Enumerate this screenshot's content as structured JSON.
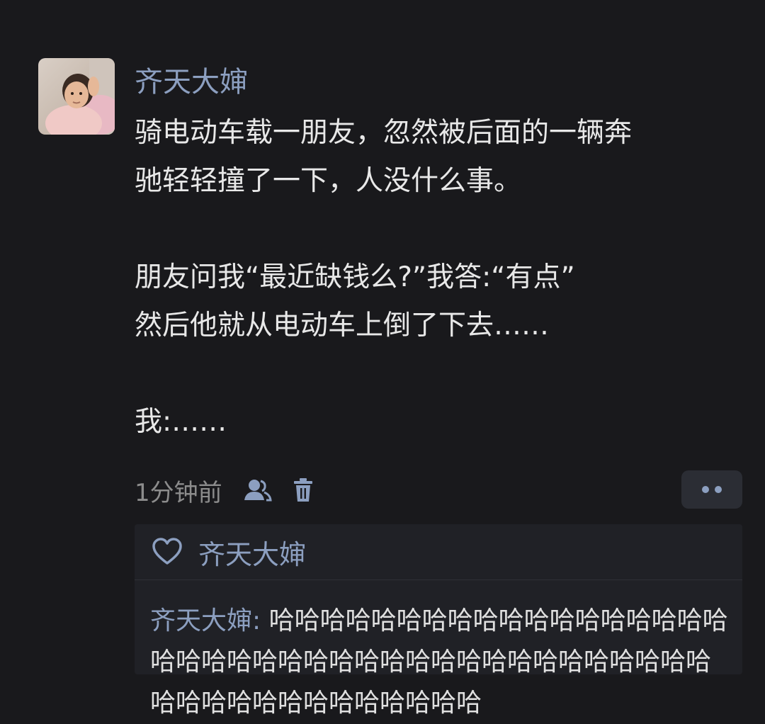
{
  "post": {
    "username": "齐天大婶",
    "lines": [
      "骑电动车载一朋友，忽然被后面的一辆奔",
      "驰轻轻撞了一下，人没什么事。",
      "",
      "朋友问我“最近缺钱么?”我答:“有点”",
      "然后他就从电动车上倒了下去……",
      "",
      "我:……"
    ],
    "timestamp": "1分钟前",
    "icons": {
      "visibility": "friends-visibility-icon",
      "delete": "trash-icon",
      "more": "more-options-icon"
    }
  },
  "interactions": {
    "like_icon": "heart-icon",
    "liked_by": "齐天大婶",
    "comments": [
      {
        "author": "齐天大婶",
        "separator": ": ",
        "text": "哈哈哈哈哈哈哈哈哈哈哈哈哈哈哈哈哈哈哈哈哈哈哈哈哈哈哈哈哈哈哈哈哈哈哈哈哈哈哈哈哈哈哈哈哈哈哈哈哈哈哈哈哈"
      }
    ]
  },
  "colors": {
    "background": "#19191c",
    "name_link": "#8c9fc0",
    "panel": "#202126",
    "muted": "#8c8c8c"
  }
}
